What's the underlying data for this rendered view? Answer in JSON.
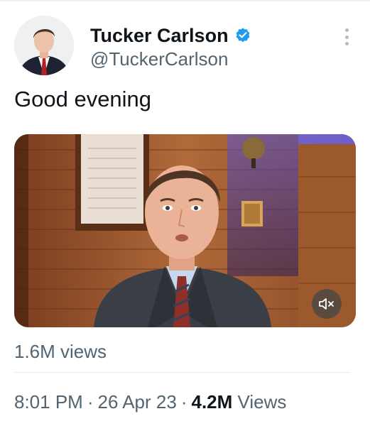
{
  "author": {
    "display_name": "Tucker Carlson",
    "handle": "@TuckerCarlson",
    "avatar_icon": "profile-photo",
    "verified_icon": "verified-badge-icon",
    "verified_color": "#1d9bf0"
  },
  "tweet": {
    "text": "Good evening"
  },
  "media": {
    "type": "video",
    "mute_icon": "speaker-muted-icon",
    "views": "1.6M views"
  },
  "meta": {
    "time": "8:01 PM",
    "separator": "·",
    "date": "26 Apr 23",
    "views_count": "4.2M",
    "views_label": "Views"
  },
  "colors": {
    "text_primary": "#0f1419",
    "text_secondary": "#536471",
    "accent": "#1d9bf0"
  }
}
